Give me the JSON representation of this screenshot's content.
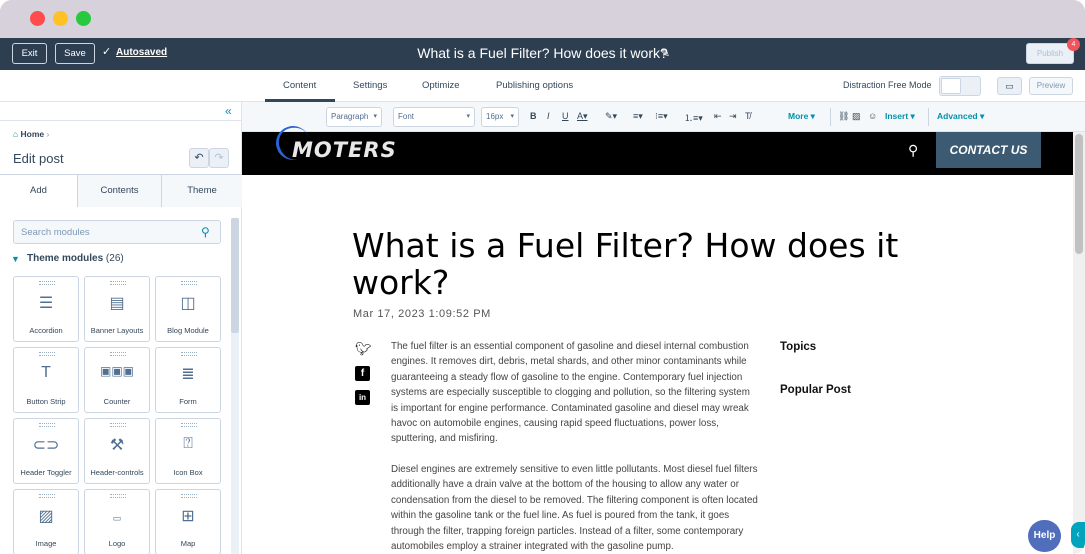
{
  "topbar": {
    "exit_label": "Exit",
    "save_label": "Save",
    "autosaved_label": "Autosaved",
    "title": "What is a Fuel Filter? How does it work?",
    "publish_label": "Publish",
    "notification_count": "4"
  },
  "tabs": [
    {
      "label": "Content"
    },
    {
      "label": "Settings"
    },
    {
      "label": "Optimize"
    },
    {
      "label": "Publishing options"
    }
  ],
  "tabrow": {
    "distraction_free_label": "Distraction Free Mode",
    "preview_label": "Preview"
  },
  "sidebar": {
    "breadcrumb_home": "Home",
    "heading": "Edit post",
    "tabs": [
      {
        "label": "Add"
      },
      {
        "label": "Contents"
      },
      {
        "label": "Theme"
      }
    ],
    "search_placeholder": "Search modules",
    "section_title": "Theme modules",
    "section_count": "(26)",
    "modules": [
      {
        "label": "Accordion"
      },
      {
        "label": "Banner Layouts"
      },
      {
        "label": "Blog Module"
      },
      {
        "label": "Button Strip"
      },
      {
        "label": "Counter"
      },
      {
        "label": "Form"
      },
      {
        "label": "Header Toggler"
      },
      {
        "label": "Header-controls"
      },
      {
        "label": "Icon Box"
      },
      {
        "label": "Image"
      },
      {
        "label": "Logo"
      },
      {
        "label": "Map"
      }
    ]
  },
  "toolbar": {
    "paragraph": "Paragraph",
    "font": "Font",
    "size": "16px",
    "bold": "B",
    "italic": "I",
    "underline": "U",
    "more": "More",
    "insert": "Insert",
    "advanced": "Advanced"
  },
  "site": {
    "logo_text": "MOTERS",
    "contact_label": "CONTACT US"
  },
  "article": {
    "title": "What is a Fuel Filter? How does it work?",
    "date": "Mar 17, 2023 1:09:52 PM",
    "paragraph1": "The fuel filter is an essential component of gasoline and diesel internal combustion engines. It removes dirt, debris, metal shards, and other minor contaminants while guaranteeing a steady flow of gasoline to the engine. Contemporary fuel injection systems are especially susceptible to clogging and pollution, so the filtering system is important for engine performance. Contaminated gasoline and diesel may wreak havoc on automobile engines, causing rapid speed fluctuations, power loss, sputtering, and misfiring.",
    "paragraph2": "Diesel engines are extremely sensitive to even little pollutants. Most diesel fuel filters additionally have a drain valve at the bottom of the housing to allow any water or condensation from the diesel to be removed. The filtering component is often located within the gasoline tank or the fuel line. As fuel is poured from the tank, it goes through the filter, trapping foreign particles. Instead of a filter, some contemporary automobiles employ a strainer integrated with the gasoline pump.",
    "topics_heading": "Topics",
    "popular_heading": "Popular Post"
  },
  "help_label": "Help"
}
